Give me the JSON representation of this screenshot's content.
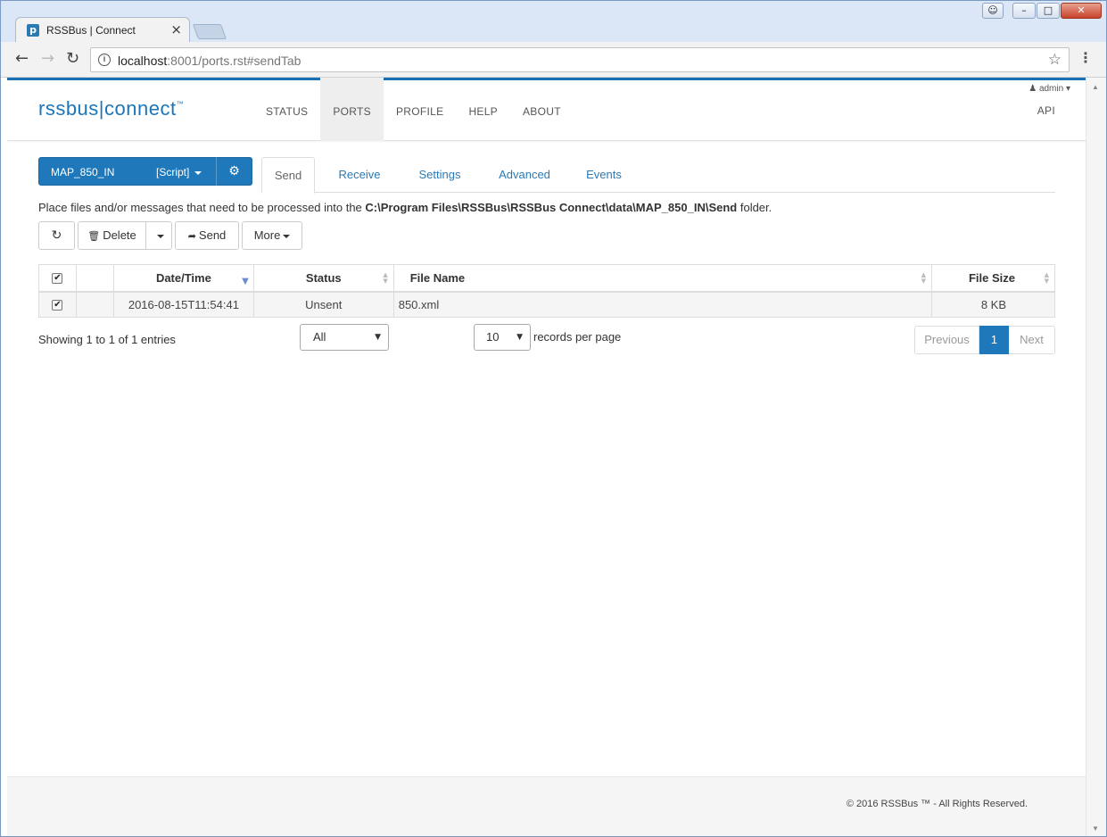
{
  "browser": {
    "tab_title": "RSSBus | Connect",
    "tab_close": "×",
    "favicon": "p",
    "url_host": "localhost",
    "url_rest": ":8001/ports.rst#sendTab",
    "icons": {
      "back": "back-arrow-icon",
      "forward": "forward-arrow-icon",
      "reload": "reload-icon",
      "info": "info-icon",
      "star": "star-icon",
      "menu": "kebab-menu-icon"
    }
  },
  "header": {
    "logo_left": "rssbus",
    "logo_sep": "|",
    "logo_right": "connect",
    "logo_tm": "™",
    "nav": [
      {
        "label": "STATUS",
        "active": false
      },
      {
        "label": "PORTS",
        "active": true
      },
      {
        "label": "PROFILE",
        "active": false
      },
      {
        "label": "HELP",
        "active": false
      },
      {
        "label": "ABOUT",
        "active": false
      }
    ],
    "user": "admin",
    "api": "API"
  },
  "port": {
    "name": "MAP_850_IN",
    "type": "[Script]",
    "accent": "#1f78b9"
  },
  "subtabs": [
    {
      "label": "Send",
      "active": true
    },
    {
      "label": "Receive",
      "active": false
    },
    {
      "label": "Settings",
      "active": false
    },
    {
      "label": "Advanced",
      "active": false
    },
    {
      "label": "Events",
      "active": false
    }
  ],
  "folder_note": {
    "prefix": "Place files and/or messages that need to be processed into the ",
    "path": "C:\\Program Files\\RSSBus\\RSSBus Connect\\data\\MAP_850_IN\\Send",
    "suffix": " folder."
  },
  "actions": {
    "delete": "Delete",
    "send": "Send",
    "more": "More"
  },
  "table": {
    "columns": [
      "Date/Time",
      "Status",
      "File Name",
      "File Size"
    ],
    "rows": [
      {
        "date": "2016-08-15T11:54:41",
        "status": "Unsent",
        "file": "850.xml",
        "size": "8 KB",
        "checked": true
      }
    ]
  },
  "footer_controls": {
    "showing": "Showing 1 to 1 of 1 entries",
    "filter_value": "All",
    "page_size": "10",
    "per_page_label": "records per page",
    "prev": "Previous",
    "page": "1",
    "next": "Next"
  },
  "footer": {
    "copyright": "© 2016 RSSBus ™ - All Rights Reserved."
  }
}
